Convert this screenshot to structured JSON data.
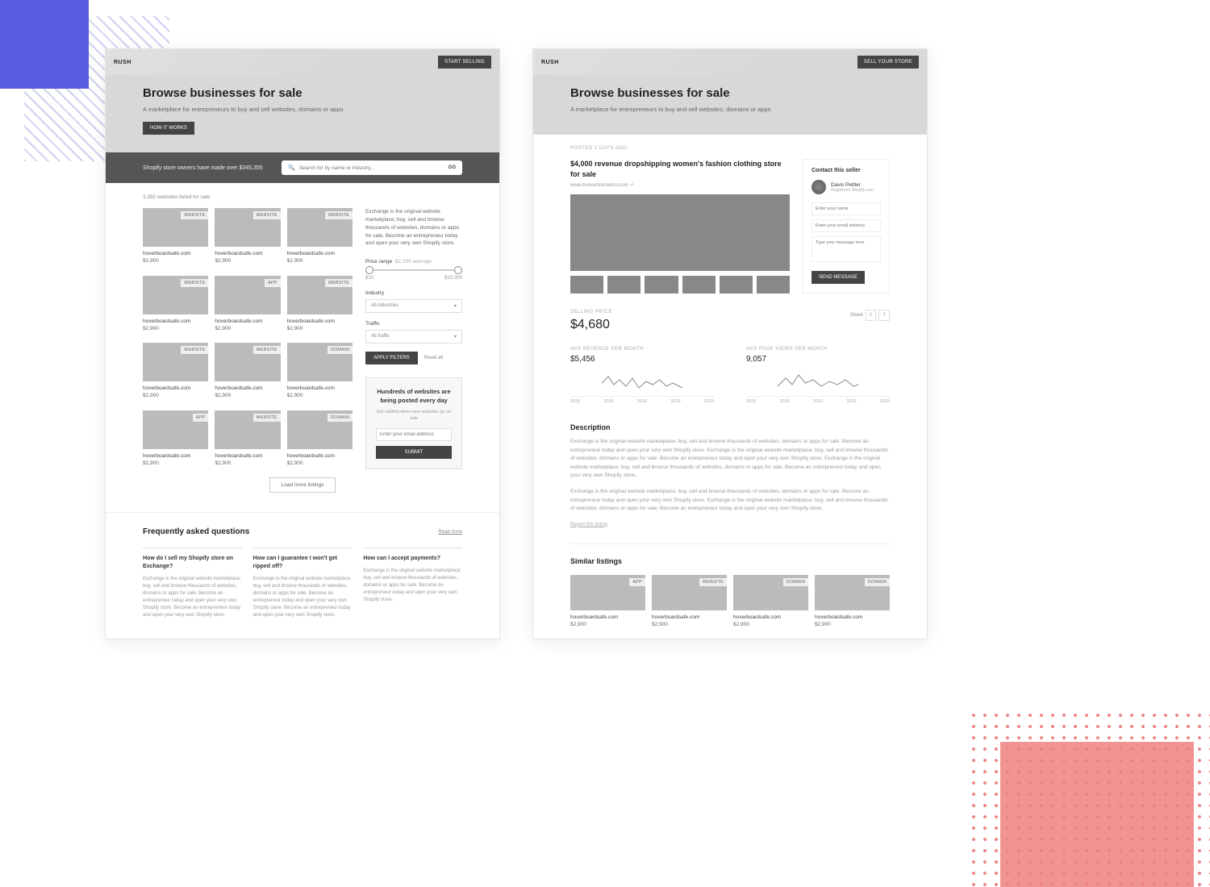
{
  "left": {
    "brand": "RUSH",
    "cta": "START SELLING",
    "hero": {
      "title": "Browse businesses for sale",
      "sub": "A marketplace for entrepreneurs to buy and sell websites, domains or apps",
      "btn": "HOW IT WORKS"
    },
    "searchbar": {
      "note": "Shopify store owners have made over $345,355",
      "placeholder": "Search for by name or industry...",
      "go": "GO"
    },
    "count": "3,392 websites listed for sale",
    "cards": [
      {
        "tag": "WEBSITE",
        "title": "hoverboardsafe.com",
        "price": "$2,900"
      },
      {
        "tag": "WEBSITE",
        "title": "hoverboardsafe.com",
        "price": "$2,900"
      },
      {
        "tag": "WEBSITE",
        "title": "hoverboardsafe.com",
        "price": "$2,900"
      },
      {
        "tag": "WEBSITE",
        "title": "hoverboardsafe.com",
        "price": "$2,900"
      },
      {
        "tag": "APP",
        "title": "hoverboardsafe.com",
        "price": "$2,900"
      },
      {
        "tag": "WEBSITE",
        "title": "hoverboardsafe.com",
        "price": "$2,900"
      },
      {
        "tag": "WEBSITE",
        "title": "hoverboardsafe.com",
        "price": "$2,900"
      },
      {
        "tag": "WEBSITE",
        "title": "hoverboardsafe.com",
        "price": "$2,900"
      },
      {
        "tag": "DOMAIN",
        "title": "hoverboardsafe.com",
        "price": "$2,900"
      },
      {
        "tag": "APP",
        "title": "hoverboardsafe.com",
        "price": "$2,900"
      },
      {
        "tag": "WEBSITE",
        "title": "hoverboardsafe.com",
        "price": "$2,900"
      },
      {
        "tag": "DOMAIN",
        "title": "hoverboardsafe.com",
        "price": "$2,900"
      }
    ],
    "side": {
      "blurb": "Exchange is the original website marketplace; buy, sell and browse thousands of websites, domains or apps for sale. Become an entrepreneur today and open your very own Shopify store.",
      "price_label": "Price range",
      "price_avg": "$2,200 average",
      "min": "$10",
      "max": "$15,000",
      "industry_label": "Industry",
      "industry_value": "All industries",
      "traffic_label": "Traffic",
      "traffic_value": "All traffic",
      "apply": "APPLY FILTERS",
      "reset": "Reset all"
    },
    "promo": {
      "title": "Hundreds of websites are being posted every day",
      "sub": "Get notified when new websites go on sale",
      "placeholder": "Enter your email address",
      "btn": "SUBMIT"
    },
    "loadmore": "Load more listings",
    "faq": {
      "title": "Frequently asked questions",
      "link": "Read more",
      "items": [
        {
          "q": "How do I sell my Shopify store on Exchange?",
          "a": "Exchange is the original website marketplace; buy, sell and browse thousands of websites, domains or apps for sale. Become an entrepreneur today and open your very own Shopify store. Become an entrepreneur today and open your very own Shopify store."
        },
        {
          "q": "How can I guarantee I won't get ripped off?",
          "a": "Exchange is the original website marketplace; buy, sell and browse thousands of websites, domains or apps for sale. Become an entrepreneur today and open your very own Shopify store. Become an entrepreneur today and open your very own Shopify store."
        },
        {
          "q": "How can I accept payments?",
          "a": "Exchange is the original website marketplace; buy, sell and browse thousands of websites, domains or apps for sale. Become an entrepreneur today and open your very own Shopify store."
        }
      ]
    }
  },
  "right": {
    "brand": "RUSH",
    "cta": "SELL YOUR STORE",
    "hero": {
      "title": "Browse businesses for sale",
      "sub": "A marketplace for entrepreneurs to buy and sell websites, domains or apps"
    },
    "posted": "POSTED 2 DAYS AGO",
    "listing": {
      "title": "$4,000 revenue dropshipping women's fashion clothing store for sale",
      "url": "www.monochromatico.com ↗"
    },
    "contact": {
      "title": "Contact this seller",
      "name": "Davis Pettler",
      "role": "Registered Shopify user",
      "name_ph": "Enter your name",
      "email_ph": "Enter your email address",
      "msg_ph": "Type your message here",
      "btn": "SEND MESSAGE"
    },
    "price": {
      "label": "SELLING PRICE",
      "value": "$4,680"
    },
    "share": {
      "label": "Share",
      "t": "t",
      "f": "f"
    },
    "stats": {
      "rev": {
        "label": "AVG REVENUE PER MONTH",
        "value": "$5,456"
      },
      "views": {
        "label": "AVG PAGE VIEWS PER MONTH",
        "value": "9,057"
      },
      "ticks": [
        "2018",
        "2019",
        "2019",
        "2019",
        "2019"
      ]
    },
    "desc": {
      "title": "Description",
      "p1": "Exchange is the original website marketplace; buy, sell and browse thousands of websites, domains or apps for sale. Become an entrepreneur today and open your very own Shopify store. Exchange is the original website marketplace; buy, sell and browse thousands of websites, domains or apps for sale. Become an entrepreneur today and open your very own Shopify store. Exchange is the original website marketplace; buy, sell and browse thousands of websites, domains or apps for sale. Become an entrepreneur today and open your very own Shopify store.",
      "p2": "Exchange is the original website marketplace; buy, sell and browse thousands of websites, domains or apps for sale. Become an entrepreneur today and open your very own Shopify store. Exchange is the original website marketplace; buy, sell and browse thousands of websites, domains or apps for sale. Become an entrepreneur today and open your very own Shopify store.",
      "report": "Report this listing"
    },
    "similar": {
      "title": "Similar listings",
      "cards": [
        {
          "tag": "APP",
          "title": "hoverboardsafe.com",
          "price": "$2,900"
        },
        {
          "tag": "WEBSITE",
          "title": "hoverboardsafe.com",
          "price": "$2,900"
        },
        {
          "tag": "DOMAIN",
          "title": "hoverboardsafe.com",
          "price": "$2,900"
        },
        {
          "tag": "DOMAIN",
          "title": "hoverboardsafe.com",
          "price": "$2,900"
        }
      ]
    }
  }
}
